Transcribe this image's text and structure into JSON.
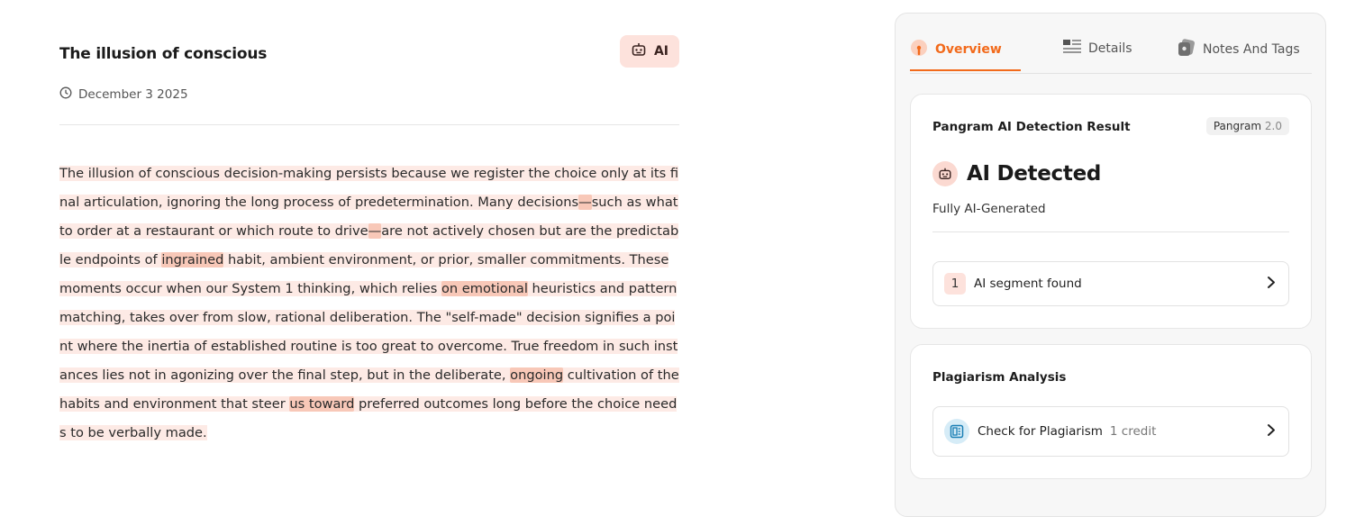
{
  "document": {
    "title": "The illusion of conscious",
    "badge_label": "AI",
    "date": "December 3 2025",
    "body_parts": [
      {
        "text": "The illusion of conscious decision-making persists because we register the choice only at its final articulation, ignoring the long process of predetermination. Many decisions",
        "hl": false
      },
      {
        "text": "—",
        "hl": true
      },
      {
        "text": "such as what to order at a restaurant or which route to drive",
        "hl": false
      },
      {
        "text": "—",
        "hl": true
      },
      {
        "text": "are not actively chosen but are the predictable endpoints of ",
        "hl": false
      },
      {
        "text": "ingrained",
        "hl": true
      },
      {
        "text": " habit, ambient environment, or prior, smaller commitments. These moments occur when our System 1 thinking, which relies ",
        "hl": false
      },
      {
        "text": "on emotional",
        "hl": true
      },
      {
        "text": " heuristics and pattern matching, takes over from slow, rational deliberation. The \"self-made\" decision signifies a point where the inertia of established routine is too great to overcome. True freedom in such instances lies not in agonizing over the final step, but in the deliberate, ",
        "hl": false
      },
      {
        "text": "ongoing",
        "hl": true
      },
      {
        "text": " cultivation of the habits and environment that steer ",
        "hl": false
      },
      {
        "text": "us toward",
        "hl": true
      },
      {
        "text": " preferred outcomes long before the choice needs to be verbally made.",
        "hl": false
      }
    ]
  },
  "panel": {
    "tabs": [
      {
        "label": "Overview",
        "icon": "gauge-icon",
        "active": true
      },
      {
        "label": "Details",
        "icon": "list-icon",
        "active": false
      },
      {
        "label": "Notes And Tags",
        "icon": "tag-icon",
        "active": false
      }
    ],
    "result_card": {
      "heading": "Pangram AI Detection Result",
      "version_name": "Pangram",
      "version_number": "2.0",
      "verdict": "AI Detected",
      "subtext": "Fully AI-Generated",
      "segment_count": "1",
      "segment_label": "AI segment found"
    },
    "plagiarism_card": {
      "heading": "Plagiarism Analysis",
      "button_label": "Check for Plagiarism",
      "credit_label": "1 credit"
    }
  },
  "colors": {
    "accent": "#f26a1b",
    "segment_bg": "#fdeae5",
    "highlight_bg": "#f8c8b8",
    "ai_badge_bg": "#fde2dc"
  }
}
